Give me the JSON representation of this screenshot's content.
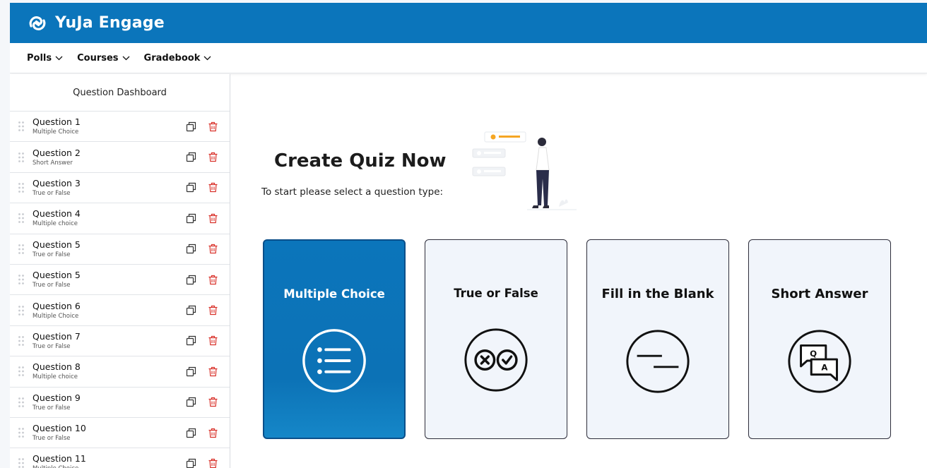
{
  "app": {
    "name": "YuJa Engage"
  },
  "nav": {
    "items": [
      {
        "label": "Polls"
      },
      {
        "label": "Courses"
      },
      {
        "label": "Gradebook"
      }
    ]
  },
  "sidebar": {
    "title": "Question Dashboard",
    "questions": [
      {
        "title": "Question 1",
        "type": "Multiple Choice"
      },
      {
        "title": "Question 2",
        "type": "Short Answer"
      },
      {
        "title": "Question 3",
        "type": "True or False"
      },
      {
        "title": "Question 4",
        "type": "Multiple choice"
      },
      {
        "title": "Question 5",
        "type": "True or False"
      },
      {
        "title": "Question 5",
        "type": "True or False"
      },
      {
        "title": "Question 6",
        "type": "Multiple Choice"
      },
      {
        "title": "Question 7",
        "type": "True or False"
      },
      {
        "title": "Question 8",
        "type": "Multiple choice"
      },
      {
        "title": "Question 9",
        "type": "True or False"
      },
      {
        "title": "Question 10",
        "type": "True or False"
      },
      {
        "title": "Question 11",
        "type": "Multiple Choice"
      }
    ]
  },
  "main": {
    "title": "Create Quiz Now",
    "subtitle": "To start please select a question type:",
    "cards": [
      {
        "label": "Multiple Choice",
        "icon": "list-icon",
        "selected": true
      },
      {
        "label": "True or False",
        "icon": "true-false-icon",
        "selected": false
      },
      {
        "label": "Fill in the Blank",
        "icon": "fill-blank-icon",
        "selected": false
      },
      {
        "label": "Short Answer",
        "icon": "short-answer-icon",
        "selected": false
      }
    ],
    "short_answer_icon_letters": {
      "q": "Q",
      "a": "A"
    }
  },
  "colors": {
    "brand": "#0b75bb",
    "delete": "#d9322b",
    "card_bg": "#f1f5fb"
  }
}
